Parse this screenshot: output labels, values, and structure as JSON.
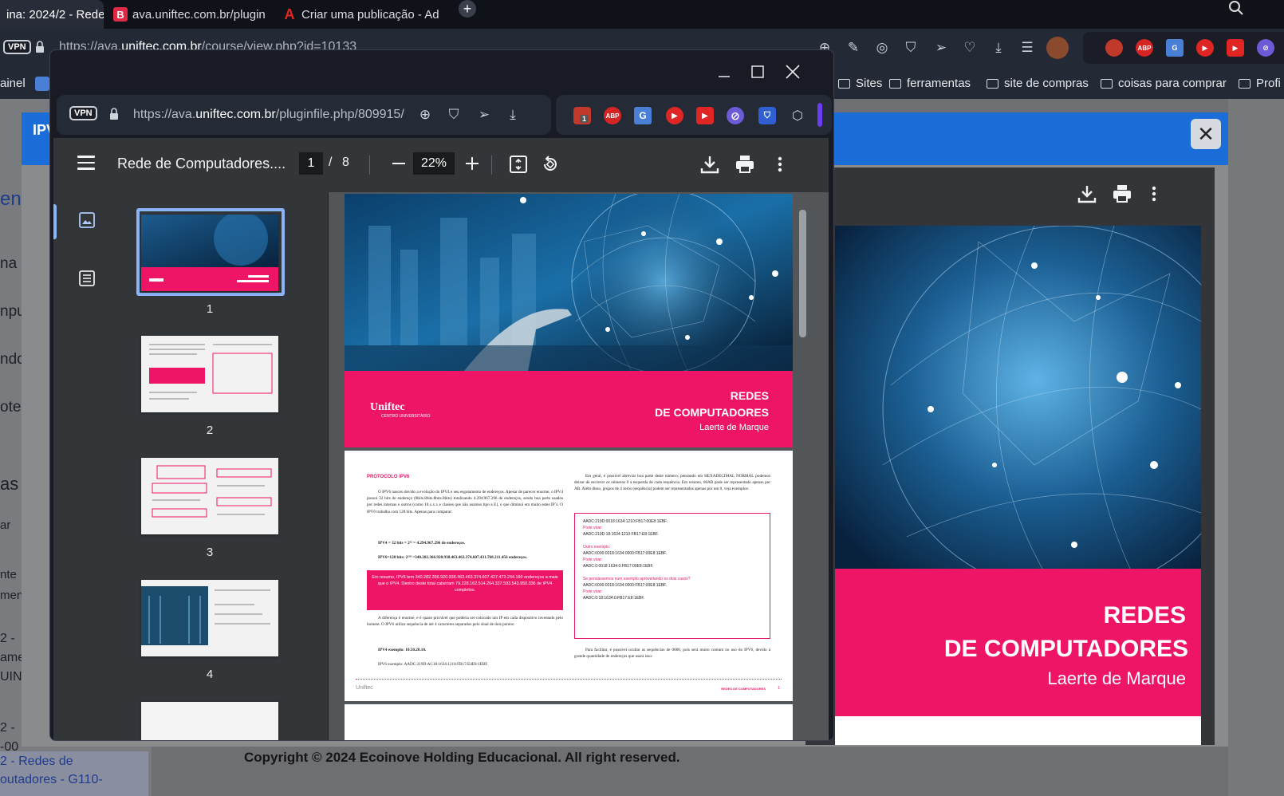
{
  "bg_browser": {
    "tabs": [
      {
        "label": "ina: 2024/2 - Redes",
        "active": true
      },
      {
        "label": "ava.uniftec.com.br/plugin",
        "favicon": "B"
      },
      {
        "label": "Criar uma publicação - Ad",
        "favicon": "A"
      }
    ],
    "vpn_label": "VPN",
    "url_prefix": "https://ava.",
    "url_domain": "uniftec.com.br",
    "url_path": "/course/view.php?id=10133",
    "bookmarks": [
      {
        "label": "ainel"
      },
      {
        "label": "Sites"
      },
      {
        "label": "ferramentas"
      },
      {
        "label": "site de compras"
      },
      {
        "label": "coisas para comprar"
      },
      {
        "label": "Profi"
      }
    ],
    "left_fragments": [
      "ent",
      "na",
      "npu",
      "ndo",
      "otec",
      "as",
      "ar",
      "nte",
      "men",
      "2 -",
      "ame",
      "UINT",
      "2 -",
      "-00"
    ],
    "left_link_line1": "2 - Redes de",
    "left_link_line2": "outadores - G110-",
    "copyright": "Copyright © 2024 Ecoinove Holding Educacional. All right reserved.",
    "modal_title": "IPV",
    "modal_close": "✕",
    "viewer2": {
      "title_line1": "REDES",
      "title_line2": "DE COMPUTADORES",
      "author": "Laerte de Marque"
    }
  },
  "popup": {
    "vpn_label": "VPN",
    "url_prefix": "https://ava.",
    "url_domain": "uniftec.com.br",
    "url_path": "/pluginfile.php/809915/",
    "extensions": [
      {
        "name": "shield-ext",
        "color": "#c0392b",
        "badge": "1"
      },
      {
        "name": "adblock-plus",
        "label": "ABP",
        "color": "#d62424"
      },
      {
        "name": "translate-ext",
        "label": "G",
        "color": "#4a7fd6"
      },
      {
        "name": "youtube-ext",
        "color": "#e02525"
      },
      {
        "name": "video-ext",
        "color": "#e02525"
      },
      {
        "name": "block-ext",
        "color": "#6b5bd6"
      },
      {
        "name": "bitwarden-ext",
        "color": "#2f5fd0"
      },
      {
        "name": "cube-ext",
        "color": "#cfd3da"
      }
    ],
    "pdf": {
      "title": "Rede de Computadores....",
      "current_page": "1",
      "page_sep": "/",
      "page_count": "8",
      "zoom": "22%",
      "thumbnails": [
        {
          "label": "1"
        },
        {
          "label": "2"
        },
        {
          "label": "3"
        },
        {
          "label": "4"
        }
      ],
      "cover": {
        "title_line1": "REDES",
        "title_line2": "DE COMPUTADORES",
        "author": "Laerte de Marque",
        "logo": "Uniftec",
        "logo_sub": "CENTRO UNIVERSITÁRIO"
      },
      "page2": {
        "heading": "PROTOCOLO IPV6",
        "para1": "O IPV6 nasceu devido a evolução do IPV4 e seu esgotamento de endereços. Apesar de parecer enorme, o IPV4 possui 32 bits de endereço (8bits.8bits.8bits.8bits) totalizando 4.294.967.296 de endereços, sendo boa parte usados por redes internas e outros (como 10.x.x.x e classes que não usamos tipo a E), o que diminui em muito estes IP´s. O IPV6 trabalha com 128 bits. Apenas para comparar:",
        "bullet1": "IPV4 = 32 bits = 2³² = 4.294.967.296 de endereços.",
        "bullet2": "IPV6=128 bits: 2¹²⁸ =340.282.366.920.938.463.463.374.607.431.768.211.456 endereços.",
        "pink_box": "Em resumo, IPV6 tem 340.282.366.920.938.463.463.374.607.427.473.244.160 endereços a mais que o IPV4. Dentro deste total caberiam 79.228.162.514.264.337.593.543.950.336 de IPV4 completos.",
        "para2": "A diferença é enorme, e é quase provável que poderia ser colocado um IP em cada dispositivo inventado pelo homem. O IPV6 utiliza sequência de até 4 caracteres separados pelo sinal de dois pontos:",
        "ipv4_example": "IPV4 exemplo: 10.50.20.10.",
        "ipv6_example": "IPV6 exemplo: AADC:219D:AC18:1634:1210:FB17:E4E8:1EBF.",
        "right_para1": "Em geral, é possível abreviar boa parte deste número; pensando em HEXADECIMAL NORMAL podemos deixar de escrever os números 0 a esquerda de cada sequência. Em resumo, 00AB pode ser representado apenas por AB. Além disso, grupos de 4 zeros (sequência) podem ser representados apenas por um 0, veja exemplos:",
        "code_lines": [
          {
            "text": "AADC:219D:0018:1634:1210:FB17:00E8:1EBF.",
            "pink": false
          },
          {
            "text": "Pode virar:",
            "pink": true
          },
          {
            "text": "AADC:219D:18:1634:1210:FB17:E8:1EBF.",
            "pink": false
          },
          {
            "text": "",
            "pink": false
          },
          {
            "text": "Outro exemplo:",
            "pink": true
          },
          {
            "text": "AADC:0000:0018:1634:0000:FB17:00E8:1EBF.",
            "pink": false
          },
          {
            "text": "Pode virar:",
            "pink": true
          },
          {
            "text": "AADC:0:0018:1634:0:FB17:00E8:1EBF.",
            "pink": false
          },
          {
            "text": "",
            "pink": false
          },
          {
            "text": "Se pensássemos num exemplo aproveitando os dois casos?",
            "pink": true
          },
          {
            "text": "AADC:0000:0018:1634:0000:FB17:00E8:1EBF.",
            "pink": false
          },
          {
            "text": "Pode virar:",
            "pink": true
          },
          {
            "text": "AADC:0:18:1634:0:FB17:E8:1EBF.",
            "pink": false
          }
        ],
        "right_para2": "Para facilitar, é possível ocultar as sequências de 0000, pois será muito comum no uso do IPV6, devido à grande quantidade de endereços que usará isso:",
        "footer_logo": "Uniftec",
        "footer_text": "REDES DE COMPUTADORES",
        "footer_page": "1"
      }
    }
  },
  "colors": {
    "brand_pink": "#ee1566",
    "modal_blue": "#1b6dd9",
    "pdf_toolbar": "#323639",
    "thumb_highlight": "#8ab4f8"
  }
}
